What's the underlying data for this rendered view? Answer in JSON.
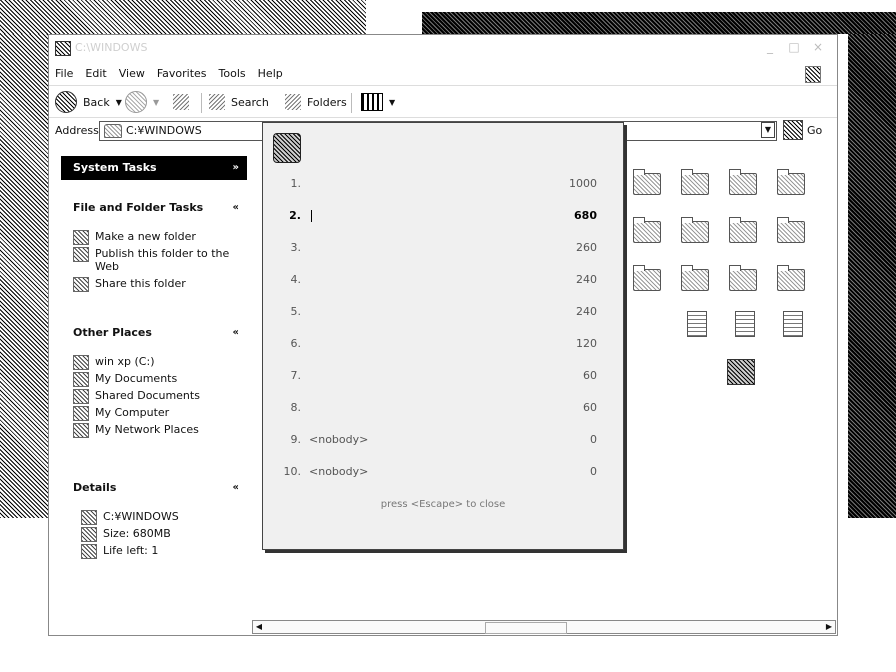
{
  "window": {
    "title": "C:\\WINDOWS"
  },
  "menu": [
    "File",
    "Edit",
    "View",
    "Favorites",
    "Tools",
    "Help"
  ],
  "toolbar": {
    "back": "Back",
    "search": "Search",
    "folders": "Folders"
  },
  "address": {
    "label": "Address",
    "value": "C:¥WINDOWS",
    "go": "Go"
  },
  "sidebar": {
    "system_tasks": {
      "title": "System Tasks",
      "chevron": "»"
    },
    "file_tasks": {
      "title": "File and Folder Tasks",
      "chevron": "«",
      "items": [
        "Make a new folder",
        "Publish this folder to the Web",
        "Share this folder"
      ]
    },
    "other_places": {
      "title": "Other Places",
      "chevron": "«",
      "items": [
        "win xp (C:)",
        "My Documents",
        "Shared Documents",
        "My Computer",
        "My Network Places"
      ]
    },
    "details": {
      "title": "Details",
      "chevron": "«",
      "items": [
        "C:¥WINDOWS",
        "Size: 680MB",
        "Life left: 1"
      ]
    }
  },
  "scores": {
    "rows": [
      {
        "rank": "1.",
        "name": "",
        "value": "1000"
      },
      {
        "rank": "2.",
        "name": "",
        "value": "680",
        "highlight": true
      },
      {
        "rank": "3.",
        "name": "",
        "value": "260"
      },
      {
        "rank": "4.",
        "name": "",
        "value": "240"
      },
      {
        "rank": "5.",
        "name": "",
        "value": "240"
      },
      {
        "rank": "6.",
        "name": "",
        "value": "120"
      },
      {
        "rank": "7.",
        "name": "",
        "value": "60"
      },
      {
        "rank": "8.",
        "name": "",
        "value": "60"
      },
      {
        "rank": "9.",
        "name": "<nobody>",
        "value": "0"
      },
      {
        "rank": "10.",
        "name": "<nobody>",
        "value": "0"
      }
    ],
    "hint": "press <Escape> to close"
  }
}
